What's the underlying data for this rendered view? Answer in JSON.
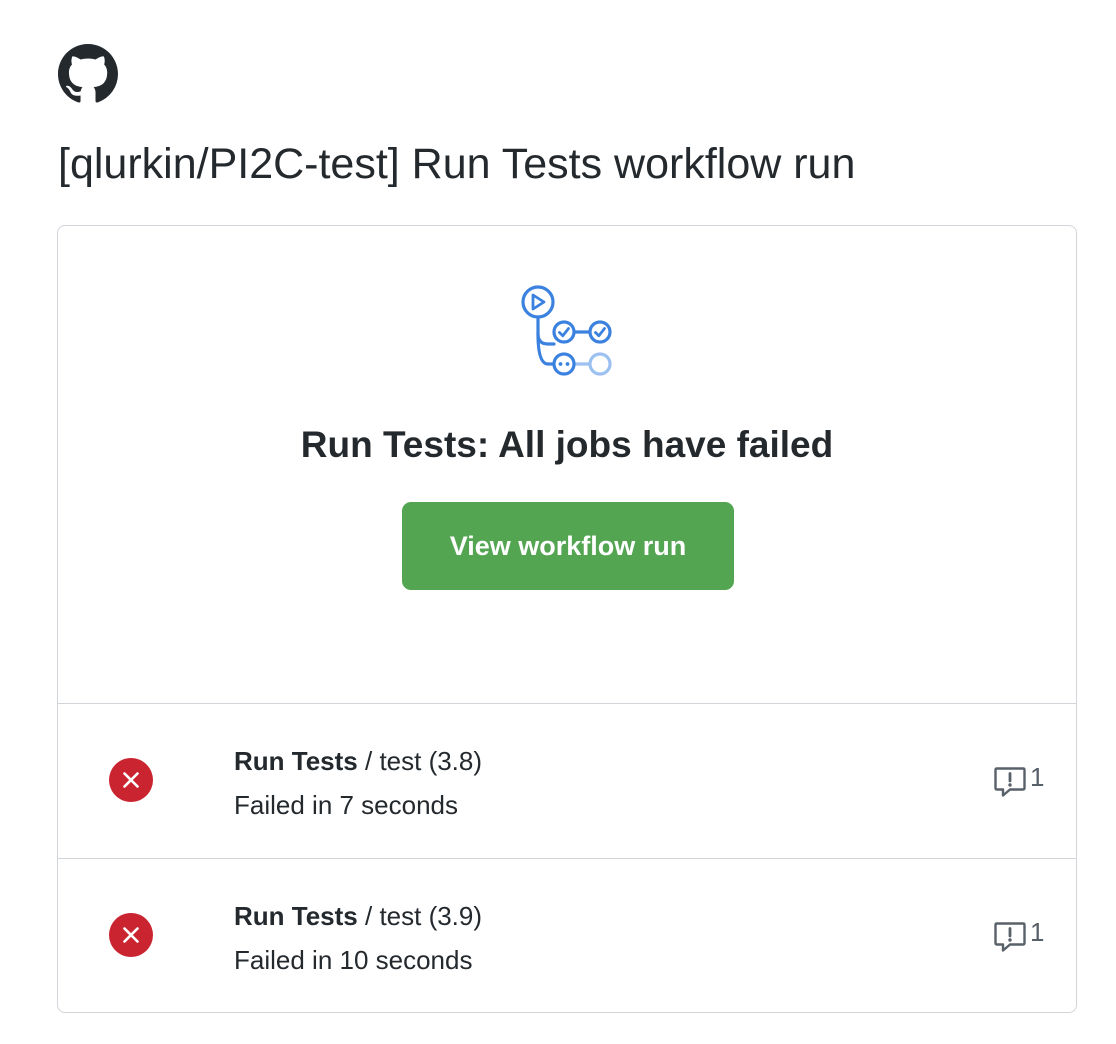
{
  "header": {
    "logo_icon": "github-octocat-icon",
    "title": "[qlurkin/PI2C-test] Run Tests workflow run"
  },
  "summary": {
    "icon": "workflow-icon",
    "heading": "Run Tests: All jobs have failed",
    "button_label": "View workflow run",
    "button_color": "#53a552"
  },
  "jobs": [
    {
      "status_icon": "x-circle-fill-icon",
      "status_color": "#cb2431",
      "workflow": "Run Tests",
      "separator": " / ",
      "job": "test (3.8)",
      "duration": "Failed in 7 seconds",
      "annotation_icon": "comment-alert-icon",
      "annotation_count": "1"
    },
    {
      "status_icon": "x-circle-fill-icon",
      "status_color": "#cb2431",
      "workflow": "Run Tests",
      "separator": " / ",
      "job": "test (3.9)",
      "duration": "Failed in 10 seconds",
      "annotation_icon": "comment-alert-icon",
      "annotation_count": "1"
    }
  ]
}
